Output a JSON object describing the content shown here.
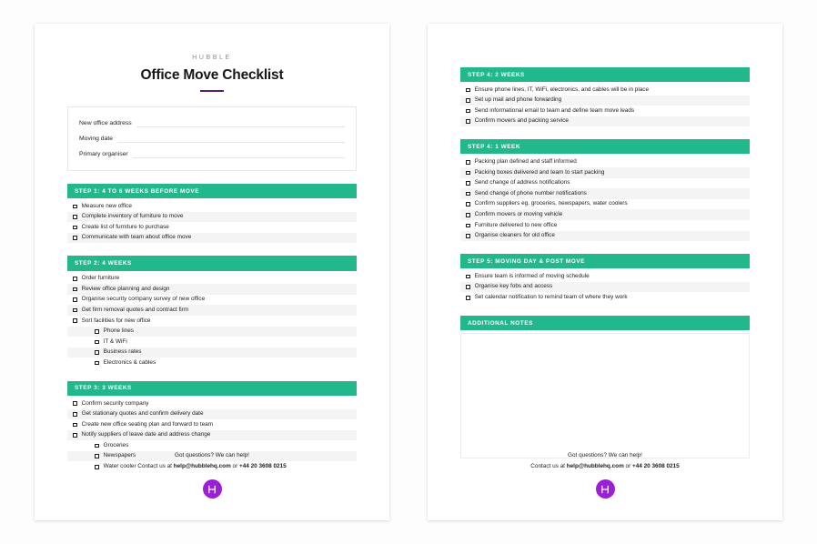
{
  "brand": "HUBBLE",
  "title": "Office Move Checklist",
  "details": {
    "fields": [
      {
        "label": "New office address"
      },
      {
        "label": "Moving date"
      },
      {
        "label": "Primary organiser"
      }
    ]
  },
  "colors": {
    "section_green": "#23b88c",
    "logo_purple": "#9b1fd6",
    "title_rule_purple": "#5c1f70",
    "stripe_gray": "#f4f4f4"
  },
  "left_page": {
    "sections": [
      {
        "heading": "STEP 1: 4 TO 6 WEEKS BEFORE MOVE",
        "tasks": [
          {
            "text": "Measure new office",
            "sub": false
          },
          {
            "text": "Complete inventory of furniture to move",
            "sub": false
          },
          {
            "text": "Create list of furniture to purchase",
            "sub": false
          },
          {
            "text": "Communicate with team about office move",
            "sub": false
          }
        ]
      },
      {
        "heading": "STEP 2: 4 WEEKS",
        "tasks": [
          {
            "text": "Order furniture",
            "sub": false
          },
          {
            "text": "Review office planning and design",
            "sub": false
          },
          {
            "text": "Organise security company survey of new office",
            "sub": false
          },
          {
            "text": "Get firm removal quotes and contract firm",
            "sub": false
          },
          {
            "text": "Sort facilities for new office",
            "sub": false
          },
          {
            "text": "Phone lines",
            "sub": true
          },
          {
            "text": "IT & WiFi",
            "sub": true
          },
          {
            "text": "Business rates",
            "sub": true
          },
          {
            "text": "Electronics & cables",
            "sub": true
          }
        ]
      },
      {
        "heading": "STEP 3: 3 WEEKS",
        "tasks": [
          {
            "text": "Confirm security company",
            "sub": false
          },
          {
            "text": "Get stationary quotes and confirm delivery date",
            "sub": false
          },
          {
            "text": "Create new office seating plan and forward to team",
            "sub": false
          },
          {
            "text": "Notify suppliers of leave date and address change",
            "sub": false
          },
          {
            "text": "Groceries",
            "sub": true
          },
          {
            "text": "Newspapers",
            "sub": true
          },
          {
            "text": "Water cooler",
            "sub": true
          }
        ]
      }
    ]
  },
  "right_page": {
    "sections": [
      {
        "heading": "STEP 4: 2 WEEKS",
        "tasks": [
          {
            "text": "Ensure phone lines, IT, WiFi, electronics, and cables will be in place",
            "sub": false
          },
          {
            "text": "Set up mail and phone forwarding",
            "sub": false
          },
          {
            "text": "Send informational email to team and define team move leads",
            "sub": false
          },
          {
            "text": "Confirm movers and packing service",
            "sub": false
          }
        ]
      },
      {
        "heading": "STEP 4: 1 WEEK",
        "tasks": [
          {
            "text": "Packing plan defined and staff informed",
            "sub": false
          },
          {
            "text": "Packing boxes delivered and team to start packing",
            "sub": false
          },
          {
            "text": "Send change of address notifications",
            "sub": false
          },
          {
            "text": "Send change of phone number notifications",
            "sub": false
          },
          {
            "text": "Confirm suppliers eg. groceries, newspapers, water coolers",
            "sub": false
          },
          {
            "text": "Confirm movers or moving vehicle",
            "sub": false
          },
          {
            "text": "Furniture delivered to new office",
            "sub": false
          },
          {
            "text": "Organise cleaners for old office",
            "sub": false
          }
        ]
      },
      {
        "heading": "STEP 5: MOVING DAY & POST MOVE",
        "tasks": [
          {
            "text": "Ensure team is informed of moving schedule",
            "sub": false
          },
          {
            "text": "Organise key fobs and access",
            "sub": false
          },
          {
            "text": "Set calendar notification to remind team of where they work",
            "sub": false
          }
        ]
      }
    ],
    "notes_heading": "ADDITIONAL NOTES"
  },
  "footer": {
    "line1": "Got questions? We can help!",
    "contact_prefix": "Contact us at ",
    "contact_email": "help@hubblehq.com",
    "contact_middle": " or ",
    "contact_phone": "+44 20 3608 0215",
    "logo_letter": "H"
  }
}
